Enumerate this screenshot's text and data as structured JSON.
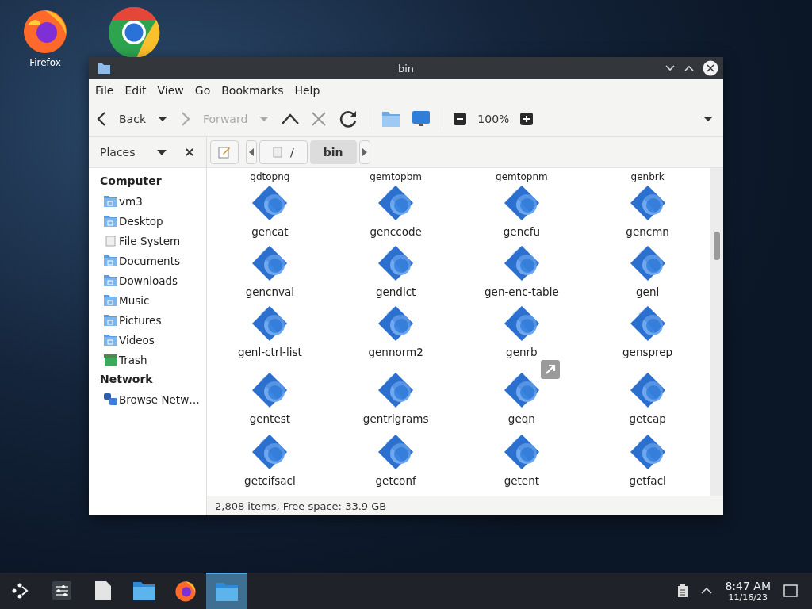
{
  "desktop_icons": [
    {
      "kind": "firefox",
      "label": "Firefox"
    },
    {
      "kind": "chrome"
    }
  ],
  "window": {
    "title": "bin"
  },
  "menu": [
    "File",
    "Edit",
    "View",
    "Go",
    "Bookmarks",
    "Help"
  ],
  "toolbar": {
    "back": {
      "label": "Back",
      "disabled": false
    },
    "forward": {
      "label": "Forward",
      "disabled": true
    },
    "stop_disabled": true,
    "zoom": "100%"
  },
  "places": {
    "title": "Places",
    "sections": [
      {
        "heading": "Computer",
        "items": [
          {
            "label": "vm3",
            "kind": "home"
          },
          {
            "label": "Desktop",
            "kind": "desktop"
          },
          {
            "label": "File System",
            "kind": "drive"
          },
          {
            "label": "Documents",
            "kind": "documents"
          },
          {
            "label": "Downloads",
            "kind": "downloads"
          },
          {
            "label": "Music",
            "kind": "music"
          },
          {
            "label": "Pictures",
            "kind": "pictures"
          },
          {
            "label": "Videos",
            "kind": "videos"
          },
          {
            "label": "Trash",
            "kind": "trash"
          }
        ]
      },
      {
        "heading": "Network",
        "items": [
          {
            "label": "Browse Netw…",
            "kind": "network"
          }
        ]
      }
    ]
  },
  "path": [
    {
      "label": "/",
      "selected": false
    },
    {
      "label": "bin",
      "selected": true
    }
  ],
  "files": {
    "cut_off_above": [
      "gdtopng",
      "gemtopbm",
      "gemtopnm",
      "genbrk"
    ],
    "items": [
      {
        "name": "gencat",
        "symlink": false
      },
      {
        "name": "genccode",
        "symlink": false
      },
      {
        "name": "gencfu",
        "symlink": false
      },
      {
        "name": "gencmn",
        "symlink": false
      },
      {
        "name": "gencnval",
        "symlink": false
      },
      {
        "name": "gendict",
        "symlink": false
      },
      {
        "name": "gen-enc-table",
        "symlink": false
      },
      {
        "name": "genl",
        "symlink": false
      },
      {
        "name": "genl-ctrl-list",
        "symlink": false
      },
      {
        "name": "gennorm2",
        "symlink": false
      },
      {
        "name": "genrb",
        "symlink": false
      },
      {
        "name": "gensprep",
        "symlink": false
      },
      {
        "name": "gentest",
        "symlink": false
      },
      {
        "name": "gentrigrams",
        "symlink": false
      },
      {
        "name": "geqn",
        "symlink": true
      },
      {
        "name": "getcap",
        "symlink": false
      },
      {
        "name": "getcifsacl",
        "symlink": false
      },
      {
        "name": "getconf",
        "symlink": false
      },
      {
        "name": "getent",
        "symlink": false
      },
      {
        "name": "getfacl",
        "symlink": false
      }
    ]
  },
  "status_bar": "2,808 items, Free space: 33.9 GB",
  "taskbar": {
    "tasks": [
      {
        "kind": "launcher",
        "selected": false
      },
      {
        "kind": "settings",
        "selected": false
      },
      {
        "kind": "document",
        "selected": false
      },
      {
        "kind": "folder",
        "selected": false
      },
      {
        "kind": "firefox",
        "selected": false
      },
      {
        "kind": "folder",
        "selected": true
      }
    ],
    "time": "8:47 AM",
    "date": "11/16/23"
  }
}
